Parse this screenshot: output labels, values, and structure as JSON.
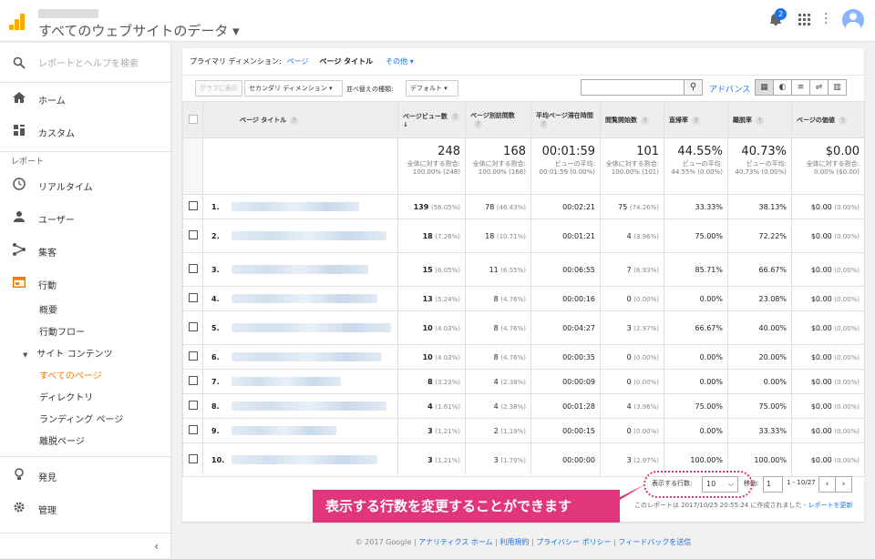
{
  "header": {
    "property_title": "すべてのウェブサイトのデータ",
    "notification_count": "2",
    "bell_icon": "bell-icon",
    "apps_icon": "apps-grid-icon",
    "menu_icon": "more-vert-icon",
    "avatar_icon": "account-avatar-icon"
  },
  "sidebar": {
    "search_placeholder": "レポートとヘルプを検索",
    "home": "ホーム",
    "custom": "カスタム",
    "reports_label": "レポート",
    "realtime": "リアルタイム",
    "users": "ユーザー",
    "acquisition": "集客",
    "behavior": "行動",
    "behavior_sub": {
      "overview": "概要",
      "flow": "行動フロー",
      "site_content": "サイト コンテンツ",
      "all_pages": "すべてのページ",
      "directory": "ディレクトリ",
      "landing": "ランディング ページ",
      "exit": "離脱ページ"
    },
    "discover": "発見",
    "admin": "管理",
    "collapse_icon": "chevron-left-icon"
  },
  "report": {
    "primary_dimension_label": "プライマリ ディメンション:",
    "dim_page": "ページ",
    "dim_page_title": "ページ タイトル",
    "dim_other": "その他 ▾",
    "graph_button": "グラフに表示",
    "secondary_dim": "セカンダリ ディメンション",
    "sort_label": "並べ替えの種類:",
    "sort_value": "デフォルト",
    "advanced": "アドバンス",
    "columns": {
      "page_title": "ページ タイトル",
      "pageviews": "ページビュー数",
      "unique_pageviews": "ページ別訪問数",
      "avg_time": "平均ページ滞在時間",
      "entrances": "閲覧開始数",
      "bounce_rate": "直帰率",
      "exit_rate": "離脱率",
      "page_value": "ページの価値"
    },
    "totals": {
      "pageviews": "248",
      "pageviews_sub": "全体に対する割合: 100.00% (248)",
      "unique": "168",
      "unique_sub": "全体に対する割合: 100.00% (168)",
      "avg_time": "00:01:59",
      "avg_time_sub": "ビューの平均: 00:01:59 (0.00%)",
      "entrances": "101",
      "entrances_sub": "全体に対する割合: 100.00% (101)",
      "bounce": "44.55%",
      "bounce_sub": "ビューの平均: 44.55% (0.00%)",
      "exit": "40.73%",
      "exit_sub": "ビューの平均: 40.73% (0.00%)",
      "value": "$0.00",
      "value_sub": "全体に対する割合: 0.00% ($0.00)"
    },
    "rows": [
      {
        "idx": "1.",
        "pv": "139",
        "pv_pct": "(56.05%)",
        "up": "78",
        "up_pct": "(46.43%)",
        "time": "00:02:21",
        "ent": "75",
        "ent_pct": "(74.26%)",
        "bounce": "33.33%",
        "exit": "38.13%",
        "val": "$0.00",
        "val_pct": "(0.00%)"
      },
      {
        "idx": "2.",
        "pv": "18",
        "pv_pct": "(7.26%)",
        "up": "18",
        "up_pct": "(10.71%)",
        "time": "00:01:21",
        "ent": "4",
        "ent_pct": "(3.96%)",
        "bounce": "75.00%",
        "exit": "72.22%",
        "val": "$0.00",
        "val_pct": "(0.00%)"
      },
      {
        "idx": "3.",
        "pv": "15",
        "pv_pct": "(6.05%)",
        "up": "11",
        "up_pct": "(6.55%)",
        "time": "00:06:55",
        "ent": "7",
        "ent_pct": "(6.93%)",
        "bounce": "85.71%",
        "exit": "66.67%",
        "val": "$0.00",
        "val_pct": "(0.00%)"
      },
      {
        "idx": "4.",
        "pv": "13",
        "pv_pct": "(5.24%)",
        "up": "8",
        "up_pct": "(4.76%)",
        "time": "00:00:16",
        "ent": "0",
        "ent_pct": "(0.00%)",
        "bounce": "0.00%",
        "exit": "23.08%",
        "val": "$0.00",
        "val_pct": "(0.00%)"
      },
      {
        "idx": "5.",
        "pv": "10",
        "pv_pct": "(4.03%)",
        "up": "8",
        "up_pct": "(4.76%)",
        "time": "00:04:27",
        "ent": "3",
        "ent_pct": "(2.97%)",
        "bounce": "66.67%",
        "exit": "40.00%",
        "val": "$0.00",
        "val_pct": "(0.00%)"
      },
      {
        "idx": "6.",
        "pv": "10",
        "pv_pct": "(4.03%)",
        "up": "8",
        "up_pct": "(4.76%)",
        "time": "00:00:35",
        "ent": "0",
        "ent_pct": "(0.00%)",
        "bounce": "0.00%",
        "exit": "20.00%",
        "val": "$0.00",
        "val_pct": "(0.00%)"
      },
      {
        "idx": "7.",
        "pv": "8",
        "pv_pct": "(3.23%)",
        "up": "4",
        "up_pct": "(2.38%)",
        "time": "00:00:09",
        "ent": "0",
        "ent_pct": "(0.00%)",
        "bounce": "0.00%",
        "exit": "0.00%",
        "val": "$0.00",
        "val_pct": "(0.00%)"
      },
      {
        "idx": "8.",
        "pv": "4",
        "pv_pct": "(1.61%)",
        "up": "4",
        "up_pct": "(2.38%)",
        "time": "00:01:28",
        "ent": "4",
        "ent_pct": "(3.96%)",
        "bounce": "75.00%",
        "exit": "75.00%",
        "val": "$0.00",
        "val_pct": "(0.00%)"
      },
      {
        "idx": "9.",
        "pv": "3",
        "pv_pct": "(1.21%)",
        "up": "2",
        "up_pct": "(1.19%)",
        "time": "00:00:15",
        "ent": "0",
        "ent_pct": "(0.00%)",
        "bounce": "0.00%",
        "exit": "33.33%",
        "val": "$0.00",
        "val_pct": "(0.00%)"
      },
      {
        "idx": "10.",
        "pv": "3",
        "pv_pct": "(1.21%)",
        "up": "3",
        "up_pct": "(1.79%)",
        "time": "00:00:00",
        "ent": "3",
        "ent_pct": "(2.97%)",
        "bounce": "100.00%",
        "exit": "100.00%",
        "val": "$0.00",
        "val_pct": "(0.00%)"
      }
    ],
    "rows_label": "表示する行数:",
    "rows_value": "10",
    "goto_label": "移動:",
    "goto_value": "1",
    "range": "1 - 10/27",
    "note": "このレポートは 2017/10/25 20:55:24 に作成されました -",
    "refresh": "レポートを更新"
  },
  "callout": "表示する行数を変更することができます",
  "footer": {
    "copyright": "© 2017 Google",
    "home": "アナリティクス ホーム",
    "terms": "利用規約",
    "privacy": "プライバシー ポリシー",
    "feedback": "フィードバックを送信"
  }
}
